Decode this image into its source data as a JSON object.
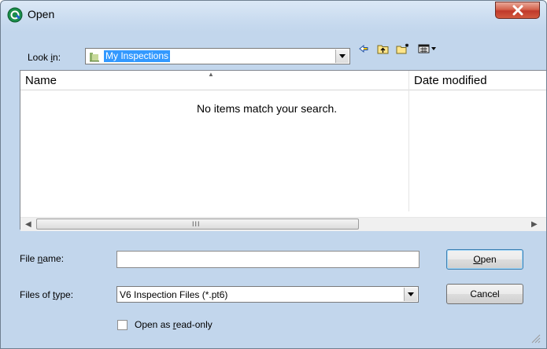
{
  "window": {
    "title": "Open",
    "close_label": "Close"
  },
  "lookin": {
    "label_pre": "Look ",
    "label_u": "i",
    "label_post": "n:",
    "value": "My Inspections"
  },
  "list": {
    "columns": [
      "Name",
      "Date modified"
    ],
    "empty_message": "No items match your search."
  },
  "filename": {
    "label_pre": "File ",
    "label_u": "n",
    "label_post": "ame:",
    "value": ""
  },
  "filetype": {
    "label_pre": "Files of ",
    "label_u": "t",
    "label_post": "ype:",
    "value": "V6 Inspection Files (*.pt6)"
  },
  "buttons": {
    "open_u": "O",
    "open_rest": "pen",
    "cancel": "Cancel"
  },
  "readonly": {
    "label_pre": "Open as ",
    "label_u": "r",
    "label_post": "ead-only",
    "checked": false
  },
  "scrollbar": {
    "grip": "III"
  }
}
